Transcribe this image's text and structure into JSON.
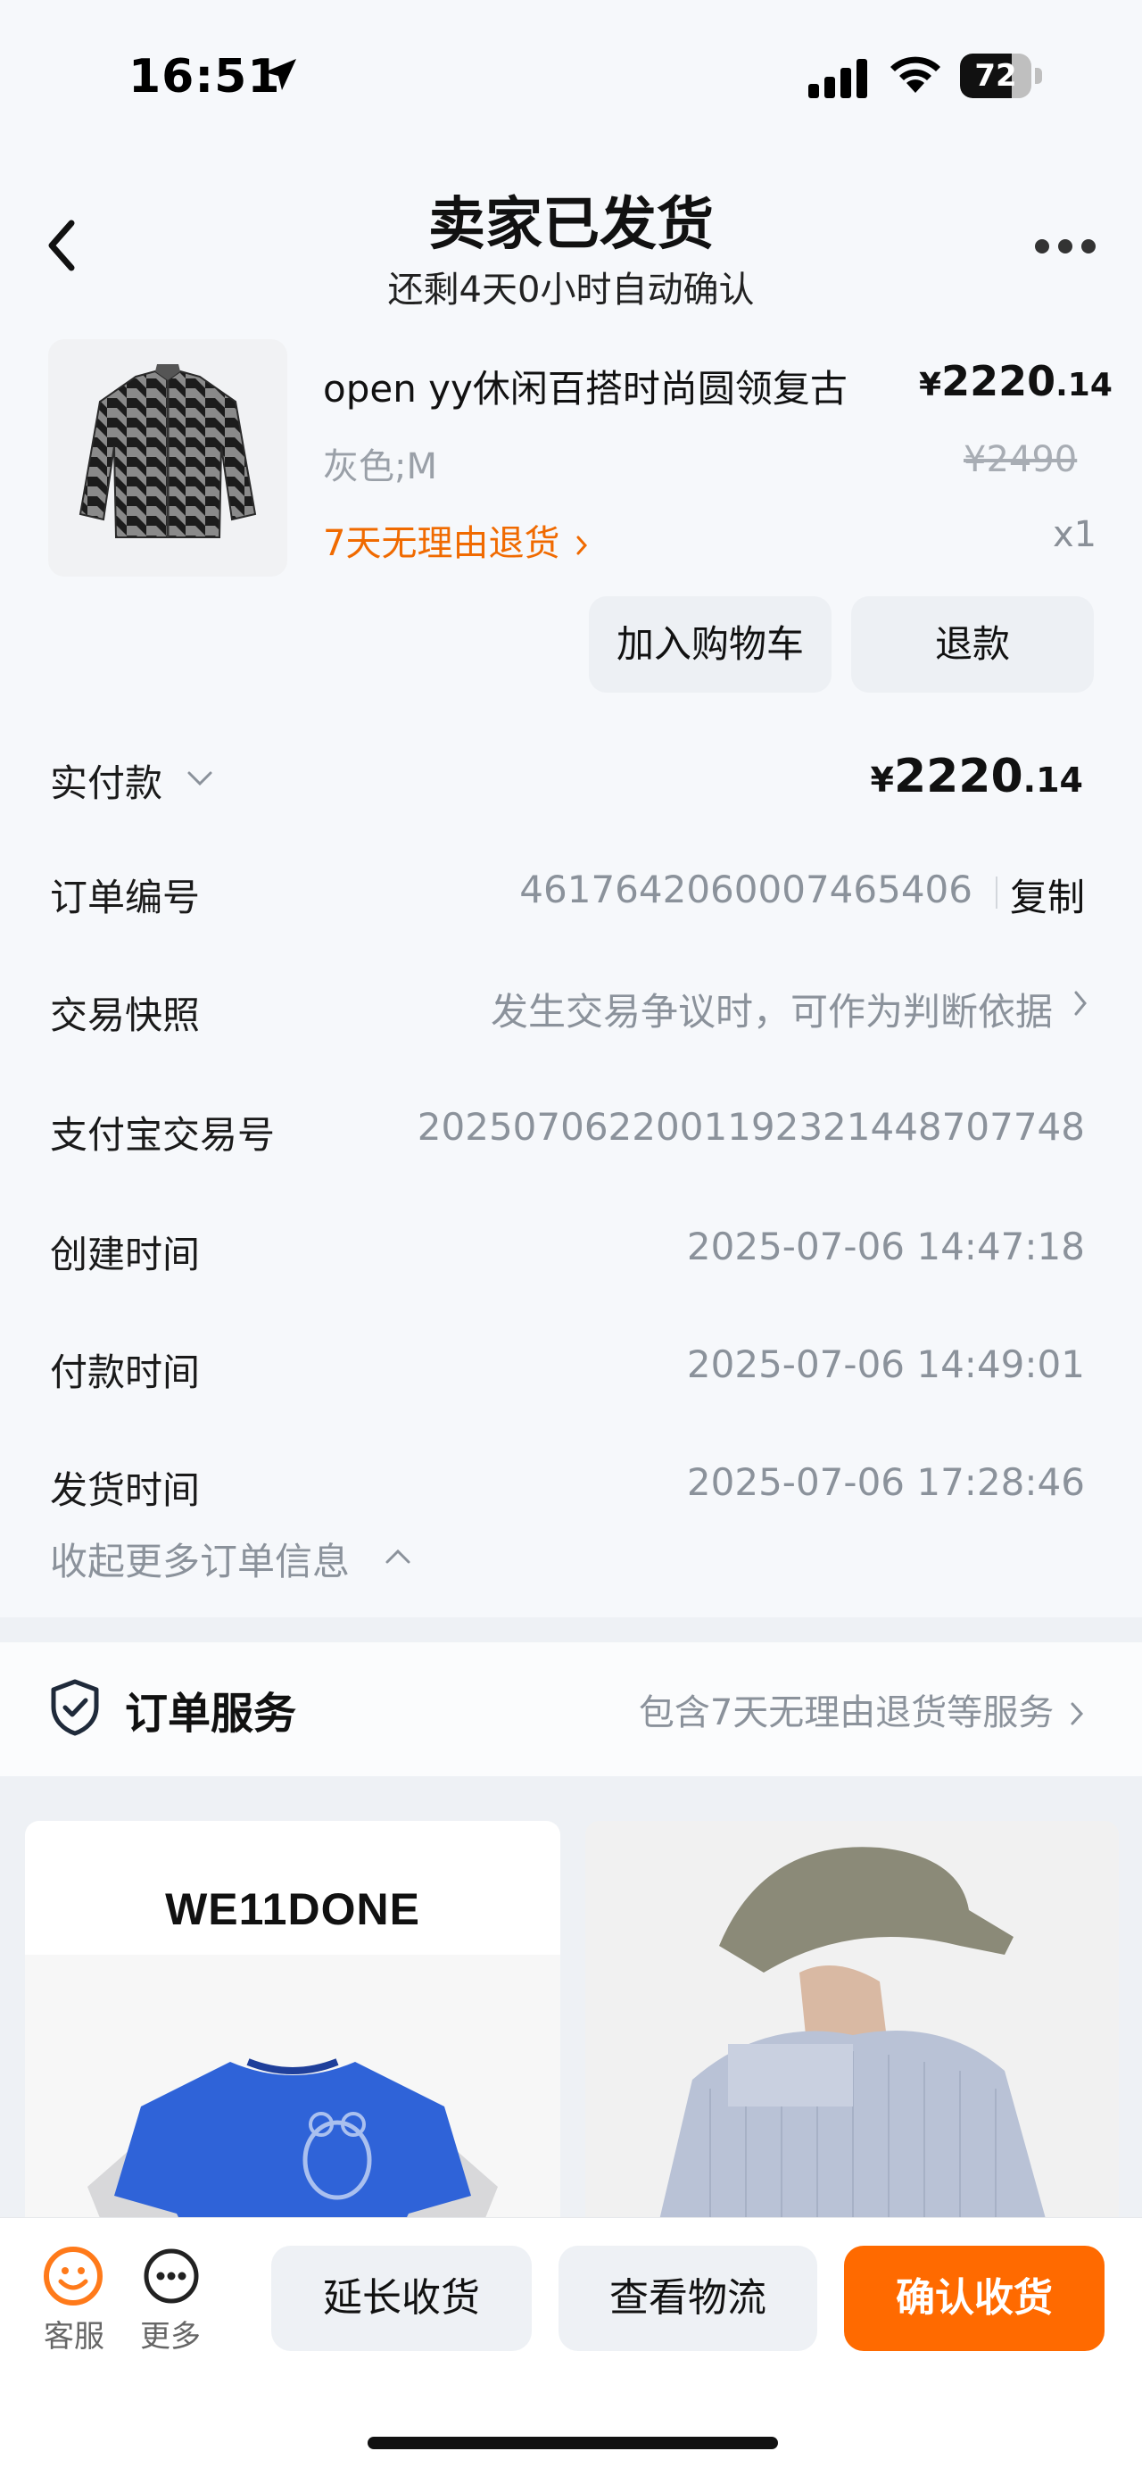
{
  "status_bar": {
    "time": "16:51",
    "battery": "72",
    "battery_level": 0.72
  },
  "header": {
    "title": "卖家已发货",
    "subtitle": "还剩4天0小时自动确认"
  },
  "product": {
    "name": "open yy休闲百搭时尚圆领复古",
    "price_symbol": "¥",
    "price_int": "2220",
    "price_dec": ".14",
    "spec": "灰色;M",
    "original_price": "¥2490",
    "return_policy": "7天无理由退货",
    "quantity": "x1"
  },
  "actions": {
    "add_to_cart": "加入购物车",
    "refund": "退款"
  },
  "order_info": {
    "paid_label": "实付款",
    "paid_symbol": "¥",
    "paid_int": "2220",
    "paid_dec": ".14",
    "order_no_label": "订单编号",
    "order_no": "4617642060007465406",
    "copy": "复制",
    "snapshot_label": "交易快照",
    "snapshot_value": "发生交易争议时，可作为判断依据",
    "alipay_label": "支付宝交易号",
    "alipay_value": "2025070622001192321448707748",
    "created_label": "创建时间",
    "created_value": "2025-07-06 14:47:18",
    "paid_time_label": "付款时间",
    "paid_time_value": "2025-07-06 14:49:01",
    "shipped_label": "发货时间",
    "shipped_value": "2025-07-06 17:28:46",
    "collapse": "收起更多订单信息"
  },
  "service": {
    "title": "订单服务",
    "desc": "包含7天无理由退货等服务"
  },
  "recommendations": [
    {
      "brand": "WE11DONE"
    }
  ],
  "bottom_bar": {
    "customer_service": "客服",
    "more": "更多",
    "extend": "延长收货",
    "logistics": "查看物流",
    "confirm": "确认收货"
  },
  "colors": {
    "accent": "#ff6a00",
    "return_orange": "#f06a00"
  }
}
